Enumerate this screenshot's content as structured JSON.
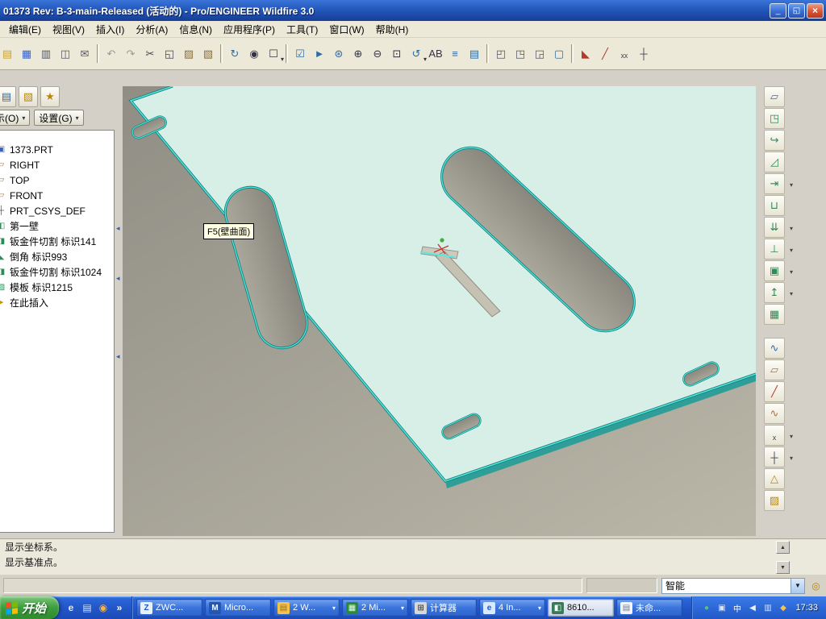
{
  "window": {
    "title": "01373 Rev: B-3-main-Released (活动的) - Pro/ENGINEER Wildfire 3.0",
    "controls": {
      "minimize": "_",
      "restore": "◱",
      "close": "×"
    }
  },
  "menu": {
    "items": [
      {
        "label": "编辑(E)",
        "name": "menu-edit"
      },
      {
        "label": "视图(V)",
        "name": "menu-view"
      },
      {
        "label": "插入(I)",
        "name": "menu-insert"
      },
      {
        "label": "分析(A)",
        "name": "menu-analysis"
      },
      {
        "label": "信息(N)",
        "name": "menu-info"
      },
      {
        "label": "应用程序(P)",
        "name": "menu-applications"
      },
      {
        "label": "工具(T)",
        "name": "menu-tools"
      },
      {
        "label": "窗口(W)",
        "name": "menu-window"
      },
      {
        "label": "帮助(H)",
        "name": "menu-help"
      }
    ]
  },
  "toolbar": {
    "icons": [
      {
        "name": "open-icon",
        "glyph": "▤",
        "color": "#c9a23d"
      },
      {
        "name": "save-icon",
        "glyph": "▦",
        "color": "#3a62c0"
      },
      {
        "name": "print-icon",
        "glyph": "▥",
        "color": "#556"
      },
      {
        "name": "print-preview-icon",
        "glyph": "◫",
        "color": "#556"
      },
      {
        "name": "mail-icon",
        "glyph": "✉",
        "color": "#556"
      },
      {
        "sep": true,
        "name": "toolbar-separator"
      },
      {
        "name": "undo-icon",
        "glyph": "↶",
        "color": "#999"
      },
      {
        "name": "redo-icon",
        "glyph": "↷",
        "color": "#999"
      },
      {
        "name": "cut-icon",
        "glyph": "✂",
        "color": "#445"
      },
      {
        "name": "copy-icon",
        "glyph": "◱",
        "color": "#445"
      },
      {
        "name": "paste-icon",
        "glyph": "▨",
        "color": "#8a6d3b"
      },
      {
        "name": "paste-special-icon",
        "glyph": "▧",
        "color": "#8a6d3b"
      },
      {
        "sep": true,
        "name": "toolbar-separator"
      },
      {
        "name": "regenerate-icon",
        "glyph": "↻",
        "color": "#2e6da4"
      },
      {
        "name": "find-icon",
        "glyph": "◉",
        "color": "#334"
      },
      {
        "name": "select-special-icon",
        "glyph": "☐",
        "color": "#334",
        "arrow": true
      },
      {
        "sep": true,
        "name": "toolbar-separator"
      },
      {
        "name": "select-filter-icon",
        "glyph": "☑",
        "color": "#2e6da4"
      },
      {
        "name": "arrow-select-icon",
        "glyph": "►",
        "color": "#2e6da4"
      },
      {
        "name": "repaint-icon",
        "glyph": "⊛",
        "color": "#2e6da4"
      },
      {
        "name": "zoom-in-icon",
        "glyph": "⊕",
        "color": "#334"
      },
      {
        "name": "zoom-out-icon",
        "glyph": "⊖",
        "color": "#334"
      },
      {
        "name": "refit-icon",
        "glyph": "⊡",
        "color": "#334"
      },
      {
        "name": "orient-icon",
        "glyph": "↺",
        "color": "#2e6da4",
        "arrow": true
      },
      {
        "name": "saved-views-icon",
        "glyph": "AB",
        "color": "#334"
      },
      {
        "name": "layers-icon",
        "glyph": "≡",
        "color": "#2e6da4"
      },
      {
        "name": "view-manager-icon",
        "glyph": "▤",
        "color": "#2e6da4"
      },
      {
        "sep": true,
        "name": "toolbar-separator"
      },
      {
        "name": "new-window-icon",
        "glyph": "◰",
        "color": "#556"
      },
      {
        "name": "window-tile-icon",
        "glyph": "◳",
        "color": "#556"
      },
      {
        "name": "window-cascade-icon",
        "glyph": "◲",
        "color": "#556"
      },
      {
        "name": "sketch-display-icon",
        "glyph": "▢",
        "color": "#2e6da4"
      },
      {
        "sep": true,
        "name": "toolbar-separator"
      },
      {
        "name": "datum-planes-toggle-icon",
        "glyph": "◣",
        "color": "#b03a2e"
      },
      {
        "name": "datum-axes-toggle-icon",
        "glyph": "╱",
        "color": "#b03a2e"
      },
      {
        "name": "datum-points-toggle-icon",
        "glyph": "ₓₓ",
        "color": "#445"
      },
      {
        "name": "datum-csys-toggle-icon",
        "glyph": "┼",
        "color": "#445"
      }
    ]
  },
  "navigator": {
    "tabs": [
      {
        "name": "model-tree-tab-icon",
        "glyph": "▤",
        "color": "#2e6da4"
      },
      {
        "name": "folder-browser-tab-icon",
        "glyph": "▧",
        "color": "#b8860b"
      },
      {
        "name": "favorites-tab-icon",
        "glyph": "★",
        "color": "#b8860b"
      }
    ],
    "show_button": "显示(O)",
    "settings_button": "设置(G)",
    "tree": [
      {
        "label": "1373.PRT",
        "glyph": "▣",
        "color": "#3a62c0",
        "name": "tree-item-part"
      },
      {
        "label": "RIGHT",
        "glyph": "▱",
        "color": "#9a7b4f",
        "name": "tree-item-right"
      },
      {
        "label": "TOP",
        "glyph": "▱",
        "color": "#9a7b4f",
        "name": "tree-item-top"
      },
      {
        "label": "FRONT",
        "glyph": "▱",
        "color": "#9a7b4f",
        "name": "tree-item-front"
      },
      {
        "label": "PRT_CSYS_DEF",
        "glyph": "┼",
        "color": "#555",
        "name": "tree-item-csys"
      },
      {
        "label": "第一壁",
        "glyph": "◧",
        "color": "#2e8b57",
        "name": "tree-item-first-wall"
      },
      {
        "label": "钣金件切割 标识141",
        "glyph": "◨",
        "color": "#2e8b57",
        "name": "tree-item-smt-cut-141"
      },
      {
        "label": "倒角 标识993",
        "glyph": "◣",
        "color": "#2e8b57",
        "name": "tree-item-chamfer-993"
      },
      {
        "label": "钣金件切割 标识1024",
        "glyph": "◨",
        "color": "#2e8b57",
        "name": "tree-item-smt-cut-1024"
      },
      {
        "label": "模板 标识1215",
        "glyph": "▨",
        "color": "#2e8b57",
        "name": "tree-item-template-1215"
      },
      {
        "label": "在此插入",
        "glyph": "►",
        "color": "#c09a00",
        "name": "tree-item-insert-here"
      }
    ]
  },
  "viewport": {
    "tooltip": "F5(壁曲面)"
  },
  "right_toolbar": {
    "icons": [
      {
        "name": "sketch-tool-icon",
        "glyph": "▱",
        "color": "#667"
      },
      {
        "name": "flat-wall-tool-icon",
        "glyph": "◳",
        "color": "#2e8b57"
      },
      {
        "name": "flange-wall-tool-icon",
        "glyph": "↪",
        "color": "#2e8b57"
      },
      {
        "name": "twist-wall-tool-icon",
        "glyph": "◿",
        "color": "#2e8b57"
      },
      {
        "name": "extend-wall-tool-icon",
        "glyph": "⇥",
        "color": "#2e8b57",
        "arrow": true
      },
      {
        "name": "merge-wall-tool-icon",
        "glyph": "⊔",
        "color": "#2e8b57"
      },
      {
        "name": "unbend-tool-icon",
        "glyph": "⇊",
        "color": "#2e8b57",
        "arrow": true
      },
      {
        "name": "bend-back-tool-icon",
        "glyph": "⊥",
        "color": "#2e8b57",
        "arrow": true
      },
      {
        "name": "bend-tool-icon",
        "glyph": "▣",
        "color": "#2e8b57",
        "arrow": true
      },
      {
        "name": "punch-tool-icon",
        "glyph": "↥",
        "color": "#2e8b57",
        "arrow": true
      },
      {
        "name": "die-tool-icon",
        "glyph": "▦",
        "color": "#2e8b57"
      },
      {
        "name": "datum-curve-tool-icon",
        "glyph": "∿",
        "color": "#2e6da4",
        "gap": true
      },
      {
        "name": "datum-plane-tool-icon",
        "glyph": "▱",
        "color": "#b0713a"
      },
      {
        "name": "datum-axis-tool-icon",
        "glyph": "╱",
        "color": "#b03a2e"
      },
      {
        "name": "sketched-curve-tool-icon",
        "glyph": "∿",
        "color": "#b0713a"
      },
      {
        "name": "datum-point-tool-icon",
        "glyph": "ₓ",
        "color": "#445",
        "arrow": true
      },
      {
        "name": "datum-csys-tool-icon",
        "glyph": "┼",
        "color": "#445",
        "arrow": true
      },
      {
        "name": "analysis-tool-icon",
        "glyph": "△",
        "color": "#b8860b"
      },
      {
        "name": "flat-pattern-tool-icon",
        "glyph": "▨",
        "color": "#b8860b"
      }
    ]
  },
  "messages": {
    "lines": [
      "显示坐标系。",
      "显示基准点。"
    ]
  },
  "status_bar": {
    "filter_value": "智能"
  },
  "taskbar": {
    "start_label": "开始",
    "quick_launch": [
      {
        "name": "ie-quick-launch-icon",
        "glyph": "e",
        "color": "#dce9ff"
      },
      {
        "name": "show-desktop-icon",
        "glyph": "▤",
        "color": "#cfe0f8"
      },
      {
        "name": "media-player-icon",
        "glyph": "◉",
        "color": "#ffb13d"
      },
      {
        "name": "quick-launch-overflow-chevron",
        "glyph": "»",
        "color": "#ffffff"
      }
    ],
    "buttons": [
      {
        "label": "ZWC...",
        "glyph": "Z",
        "iconcolor": "#1a5ad0",
        "iconbg": "#e8f0fa",
        "name": "task-button-zwcad"
      },
      {
        "label": "Micro...",
        "glyph": "M",
        "iconcolor": "#ffffff",
        "iconbg": "#2456b0",
        "name": "task-button-microsoft"
      },
      {
        "label": "2 W...",
        "glyph": "▤",
        "iconcolor": "#9a6b1a",
        "iconbg": "#f2c24e",
        "arrow": true,
        "name": "task-button-windows-group"
      },
      {
        "label": "2 Mi...",
        "glyph": "▦",
        "iconcolor": "#eaffea",
        "iconbg": "#2a8a3a",
        "arrow": true,
        "name": "task-button-mi-group"
      },
      {
        "label": "计算器",
        "glyph": "⊞",
        "iconcolor": "#444444",
        "iconbg": "#d8d8d8",
        "name": "task-button-calculator"
      },
      {
        "label": "4 In...",
        "glyph": "e",
        "iconcolor": "#1a5ad0",
        "iconbg": "#dce9f8",
        "arrow": true,
        "name": "task-button-internet-group"
      },
      {
        "label": "8610...",
        "glyph": "◧",
        "iconcolor": "#eafff2",
        "iconbg": "#3a7a5a",
        "active": true,
        "name": "task-button-proe-8610"
      },
      {
        "label": "未命...",
        "glyph": "▤",
        "iconcolor": "#6a7a9a",
        "iconbg": "#f5f5f5",
        "name": "task-button-untitled"
      }
    ],
    "tray": [
      {
        "name": "tray-messenger-icon",
        "glyph": "●",
        "color": "#58c470"
      },
      {
        "name": "tray-security-icon",
        "glyph": "▣",
        "color": "#d8e4f8"
      },
      {
        "name": "tray-language-icon",
        "glyph": "中",
        "color": "#ffffff"
      },
      {
        "name": "tray-volume-icon",
        "glyph": "◀",
        "color": "#e8f0fc"
      },
      {
        "name": "tray-network-icon",
        "glyph": "▥",
        "color": "#cfe0f8"
      },
      {
        "name": "tray-update-icon",
        "glyph": "◆",
        "color": "#f2c24e"
      }
    ],
    "clock": "17:33"
  },
  "colors": {
    "titlebar_blue": "#2458bc",
    "taskbar_blue": "#2a66d8",
    "part_fill": "#d8efe7",
    "edge_highlight": "#55ece4",
    "viewport_bg": "#a3a095"
  }
}
